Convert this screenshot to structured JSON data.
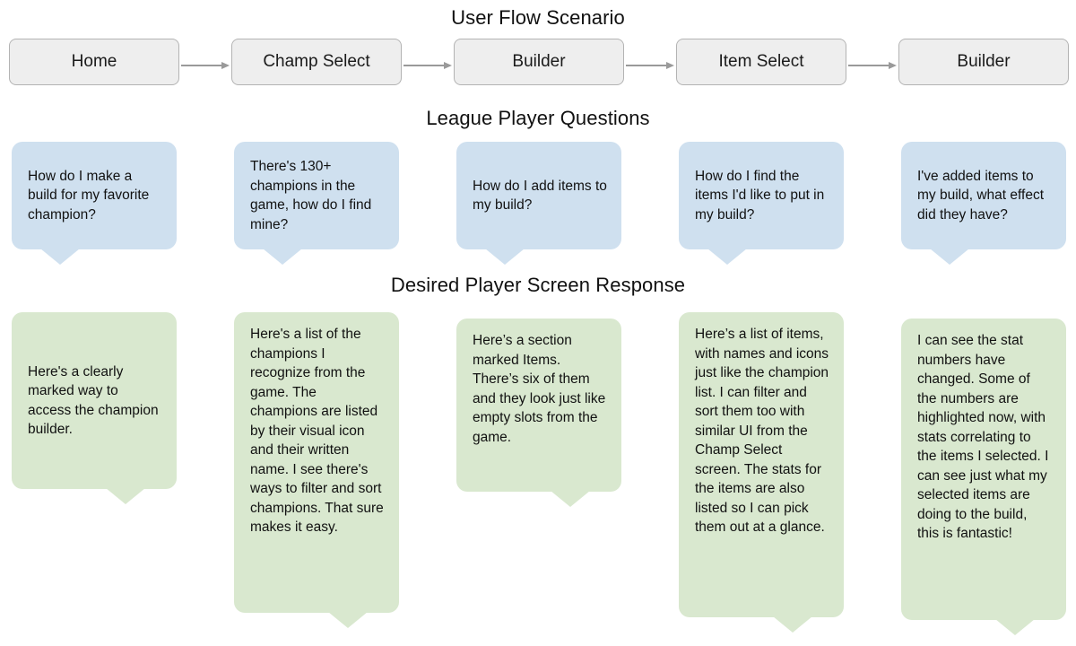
{
  "sections": {
    "flow_title": "User Flow Scenario",
    "questions_title": "League Player Questions",
    "responses_title": "Desired Player Screen Response"
  },
  "flow_steps": [
    {
      "label": "Home"
    },
    {
      "label": "Champ Select"
    },
    {
      "label": "Builder"
    },
    {
      "label": "Item Select"
    },
    {
      "label": "Builder"
    }
  ],
  "questions": [
    {
      "text": "How do I make a build for my favorite champion?"
    },
    {
      "text": "There's 130+ champions in the game, how do I find mine?"
    },
    {
      "text": "How do I add items to my build?"
    },
    {
      "text": "How do I find the items I'd like to put in my build?"
    },
    {
      "text": "I've added items to my build, what effect did they have?"
    }
  ],
  "responses": [
    {
      "text": "Here's a clearly marked way to access the champion builder."
    },
    {
      "text": "Here's a list of the champions I recognize from the game. The champions are listed by their visual icon and their written name. I see there's ways to filter and sort champions. That sure makes it easy."
    },
    {
      "text": "Here’s a section marked Items. There’s six of them and they look just like empty slots from the game."
    },
    {
      "text": "Here’s a list of items, with names and icons just like the champion list. I can filter and sort them too with similar UI from the Champ Select screen. The stats for the items are also listed so I can pick them out at a glance."
    },
    {
      "text": "I can see the stat numbers have changed. Some of the numbers are highlighted now, with stats correlating to the items I selected. I can see just what my selected items are doing to the build, this is fantastic!"
    }
  ],
  "colors": {
    "question_bubble": "#cfe0ef",
    "response_bubble": "#d9e8cf",
    "flow_box": "#eeeeee",
    "flow_box_border": "#b3b3b3",
    "arrow": "#9a9a9a",
    "text": "#111111",
    "background": "#ffffff"
  }
}
